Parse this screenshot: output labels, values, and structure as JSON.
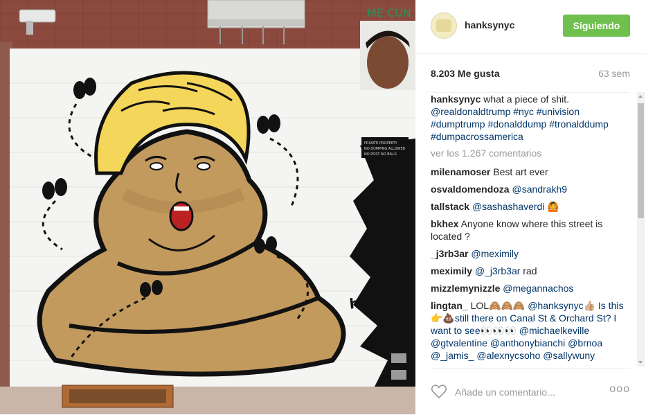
{
  "post": {
    "username": "hanksynyc",
    "follow_label": "Siguiendo",
    "likes": "8.203 Me gusta",
    "time": "63 sem",
    "caption": {
      "user": "hanksynyc",
      "text": "what a piece of shit.",
      "tags": "@realdonaldtrump #nyc #univision #dumptrump #donalddump #tronalddump #dumpacrossamerica"
    },
    "view_all": "ver los 1.267 comentarios"
  },
  "comments": [
    {
      "user": "milenamoser",
      "text": "Best art ever",
      "mention": ""
    },
    {
      "user": "osvaldomendoza",
      "text": "",
      "mention": "@sandrakh9"
    },
    {
      "user": "tallstack",
      "text": "",
      "mention": "@sashashaverdi 🙆"
    },
    {
      "user": "bkhex",
      "text": "Anyone know where this street is located ?",
      "mention": ""
    },
    {
      "user": "_j3rb3ar",
      "text": "",
      "mention": "@meximily"
    },
    {
      "user": "meximily",
      "text": "rad",
      "mention": "@_j3rb3ar"
    },
    {
      "user": "mizzlemynizzle",
      "text": "",
      "mention": "@megannachos"
    },
    {
      "user": "lingtan_",
      "text": "LOL🙈🙈🙈",
      "mention": "@hanksynyc👍🏼 Is this👉💩still there on Canal St & Orchard St? I want to see👀👀👀 @michaelkeville @gtvalentine @anthonybianchi @brnoa @_jamis_ @alexnycsoho @sallywuny"
    }
  ],
  "footer": {
    "add_comment_placeholder": "Añade un comentario...",
    "more_label": "ooo"
  },
  "artwork": {
    "signature": "hanksy",
    "sign_lines": [
      "PRIVATE PROPERTY",
      "NO DUMPING ALLOWED",
      "NO POST NO BILLS"
    ],
    "wall_text": "ME CUN"
  },
  "colors": {
    "follow_green": "#70c050",
    "link_blue": "#003569",
    "muted_gray": "#999999",
    "poop_brown": "#c39a5e",
    "hair_yellow": "#f4d65a"
  }
}
